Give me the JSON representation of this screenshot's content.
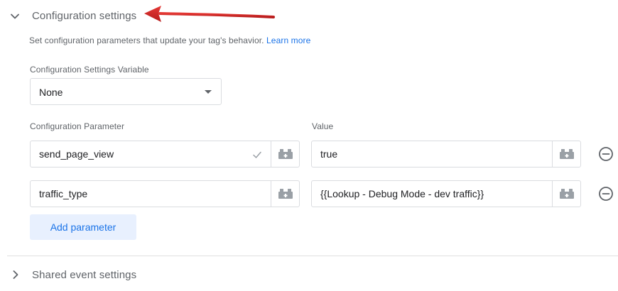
{
  "config_section": {
    "title": "Configuration settings",
    "description": "Set configuration parameters that update your tag's behavior.",
    "learn_more": "Learn more"
  },
  "settings_variable": {
    "label": "Configuration Settings Variable",
    "value": "None"
  },
  "columns": {
    "parameter_label": "Configuration Parameter",
    "value_label": "Value"
  },
  "rows": [
    {
      "parameter": "send_page_view",
      "value": "true",
      "parameter_validated": true
    },
    {
      "parameter": "traffic_type",
      "value": "{{Lookup - Debug Mode - dev traffic}}",
      "parameter_validated": false
    }
  ],
  "add_parameter_label": "Add parameter",
  "shared_section": {
    "title": "Shared event settings"
  },
  "icons": {
    "expanded_chevron": "chevron-down-icon",
    "collapsed_chevron": "chevron-right-icon",
    "variable": "variable-picker-icon",
    "remove": "remove-circle-icon",
    "check": "check-icon",
    "annotation": "red-arrow-annotation"
  },
  "colors": {
    "link": "#1a73e8",
    "annotation_arrow": "#d32f2f",
    "button_bg": "#e8f0fe"
  }
}
